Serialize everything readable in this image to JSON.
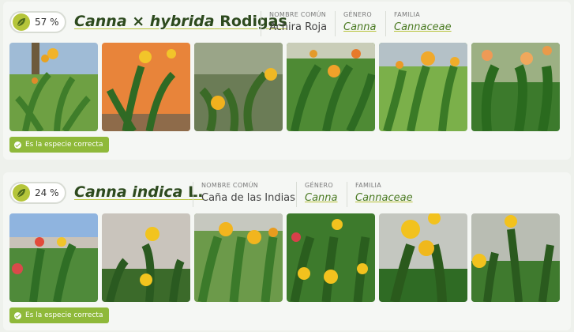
{
  "results": [
    {
      "score": "57 %",
      "species": "Canna × hybrida",
      "author": "Rodigas",
      "common_label": "NOMBRE COMÚN",
      "common_name": "Achira Roja",
      "genus_label": "GÉNERO",
      "genus": "Canna",
      "family_label": "FAMILIA",
      "family": "Cannaceae",
      "badge": "Es la especie correcta",
      "photos": [
        "photo-1",
        "photo-2",
        "photo-3",
        "photo-4",
        "photo-5",
        "photo-6"
      ]
    },
    {
      "score": "24 %",
      "species": "Canna indica",
      "author": "L.",
      "common_label": "NOMBRE COMÚN",
      "common_name": "Caña de las Indias",
      "genus_label": "GÉNERO",
      "genus": "Canna",
      "family_label": "FAMILIA",
      "family": "Cannaceae",
      "badge": "Es la especie correcta",
      "photos": [
        "photo-1",
        "photo-2",
        "photo-3",
        "photo-4",
        "photo-5",
        "photo-6"
      ]
    }
  ],
  "icons": {
    "score": "leaf-icon",
    "badge": "check-circle-icon"
  },
  "colors": {
    "accent": "#8fb93a",
    "title": "#2d4a1e",
    "link": "#4a7a22",
    "underline": "#b7c23a"
  }
}
